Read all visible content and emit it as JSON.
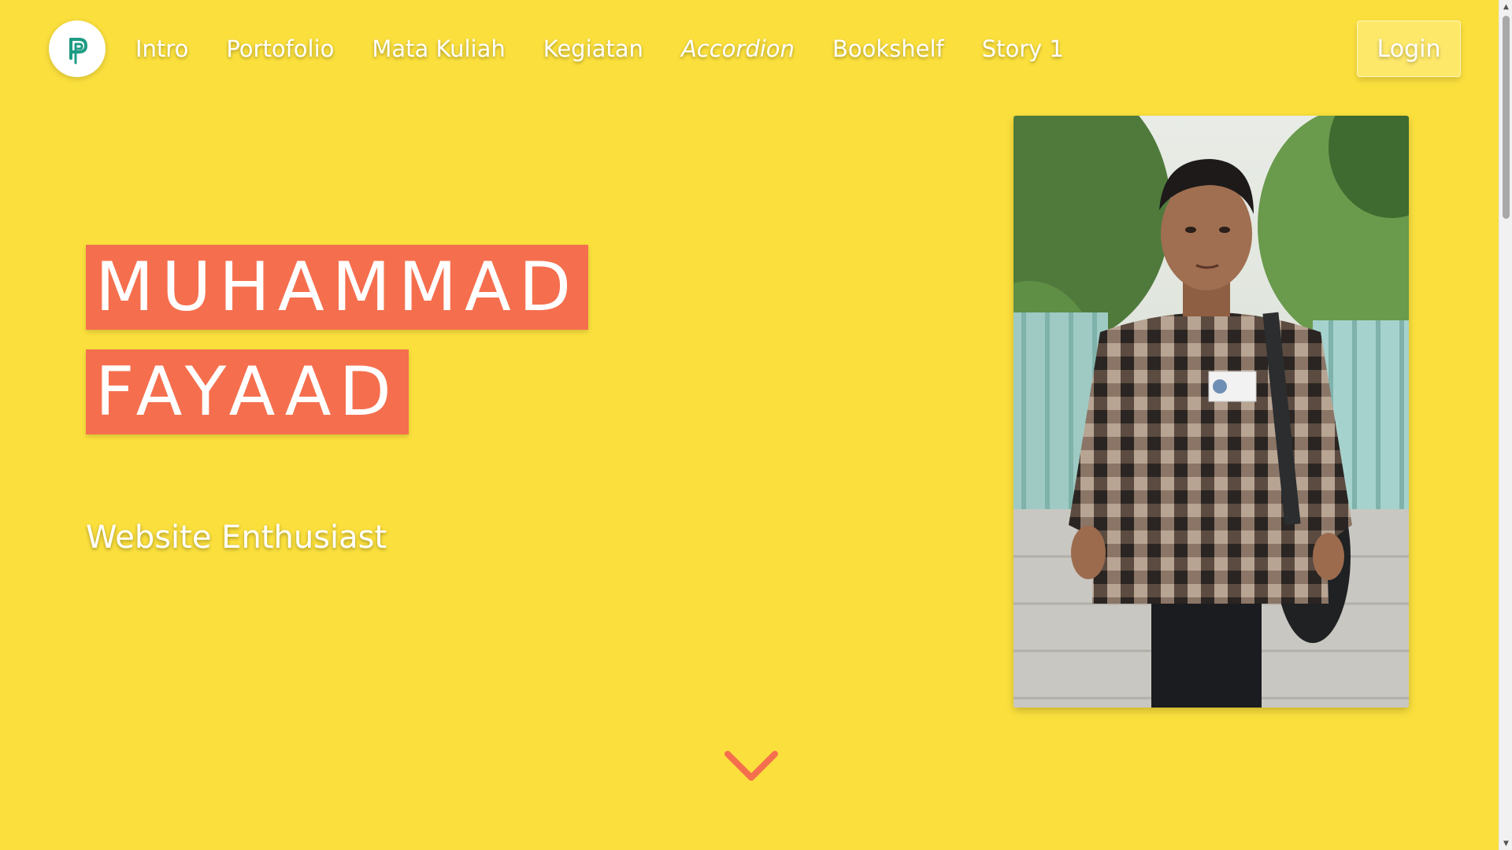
{
  "nav": {
    "links": [
      {
        "label": "Intro"
      },
      {
        "label": "Portofolio"
      },
      {
        "label": "Mata Kuliah"
      },
      {
        "label": "Kegiatan"
      },
      {
        "label": "Accordion"
      },
      {
        "label": "Bookshelf"
      },
      {
        "label": "Story 1"
      }
    ],
    "login_label": "Login",
    "logo_icon": "p-logo-icon"
  },
  "hero": {
    "name_line_1": "MUHAMMAD",
    "name_line_2": "FAYAAD",
    "subtitle": "Website Enthusiast",
    "photo_icon": "profile-photo",
    "scroll_icon": "chevron-down-icon"
  },
  "colors": {
    "background": "#fbe03d",
    "name_highlight": "#f56f4e",
    "logo_accent": "#1e9c84",
    "chevron": "#f56f4e",
    "text": "#ffffff"
  }
}
